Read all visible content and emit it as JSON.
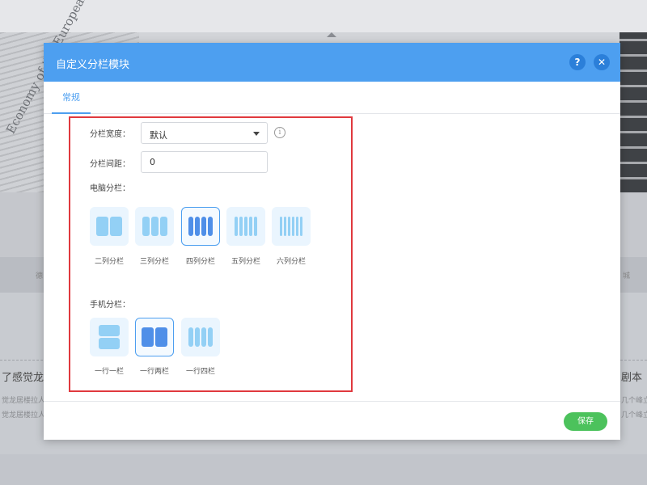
{
  "background": {
    "card_title_left": "了感觉龙",
    "card_title_right": "剧本",
    "card_sub_left_1": "觉龙居楼拉人",
    "card_sub_left_2": "觉龙居楼拉人",
    "card_sub_right_1": "几个峰立",
    "card_sub_right_2": "几个峰立",
    "strip_left": "德",
    "strip_right": "城",
    "newspaper_title": "Economy of the European"
  },
  "modal": {
    "title": "自定义分栏模块",
    "help_icon": "?",
    "close_icon": "✕",
    "tab_general": "常规",
    "column_width_label": "分栏宽度：",
    "column_width_value": "默认",
    "info_icon": "i",
    "column_gap_label": "分栏间距：",
    "column_gap_value": "0",
    "pc_columns_label": "电脑分栏：",
    "pc_options": [
      {
        "label": "二列分栏",
        "columns": 2,
        "selected": false
      },
      {
        "label": "三列分栏",
        "columns": 3,
        "selected": false
      },
      {
        "label": "四列分栏",
        "columns": 4,
        "selected": true
      },
      {
        "label": "五列分栏",
        "columns": 5,
        "selected": false
      },
      {
        "label": "六列分栏",
        "columns": 6,
        "selected": false
      }
    ],
    "mobile_columns_label": "手机分栏：",
    "mobile_options": [
      {
        "label": "一行一栏",
        "columns": 1,
        "selected": false
      },
      {
        "label": "一行两栏",
        "columns": 2,
        "selected": true
      },
      {
        "label": "一行四栏",
        "columns": 4,
        "selected": false
      }
    ],
    "save_label": "保存"
  },
  "colors": {
    "header_blue": "#4d9ff0",
    "highlight_red": "#e0393e",
    "save_green": "#4cc25c",
    "option_light": "#93d0f5",
    "option_selected": "#4f8fe8"
  }
}
